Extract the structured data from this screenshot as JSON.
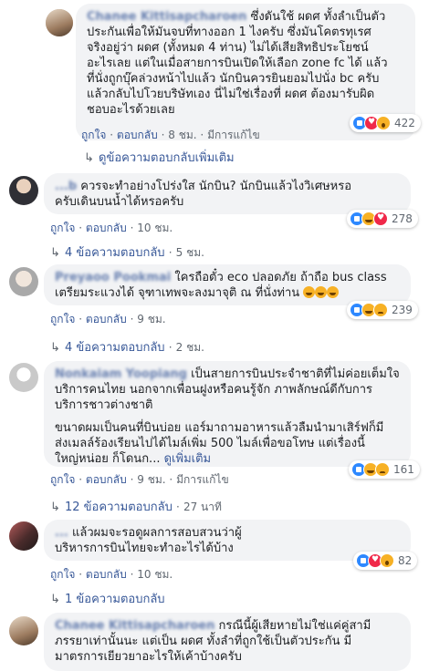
{
  "comments": [
    {
      "author": "Chanee Kittisapcharoen",
      "text_lines": [
        "ซึ่งดันใช้ ผดศ ทั้งลำเป็นตัว",
        "ประกันเพื่อให้มันจบที่ทางออก 1 ไงครับ ซึ่งมันโคตรทุเรศ",
        "จริงอยู่ว่า ผดศ (ทั้งหมด 4 ท่าน) ไม่ได้เสียสิทธิประโยชน์",
        "อะไรเลย แต่ในเมื่อสายการบินเปิดให้เลือก zone fc ได้ แล้ว",
        "ที่นั่งถูกบุ๊คล่วงหน้าไปแล้ว นักบินควรยินยอมไปนั่ง bc ครับ",
        "แล้วกลับไปโวยบริษัทเอง นี่ไม่ใช่เรื่องที่ ผดศ ต้องมารับผิด",
        "ชอบอะไรด้วยเลย"
      ],
      "like": "ถูกใจ",
      "reply": "ตอบกลับ",
      "time": "8 ชม.",
      "edited": "มีการแก้ไข",
      "reaction_count": "422",
      "reactions": [
        "like-icon",
        "love-icon",
        "wow-icon"
      ]
    },
    {
      "author": "...b",
      "text_lines": [
        "ควรจะทำอย่างโปร่งใส นักบิน? นักบินแล้วไงวิเศษหรอ",
        "ครับเดินบนน้ำได้หรอครับ"
      ],
      "like": "ถูกใจ",
      "reply": "ตอบกลับ",
      "time": "10 ชม.",
      "reaction_count": "278",
      "reactions": [
        "like-icon",
        "haha-icon",
        "love-icon"
      ],
      "replies_link": "4 ข้อความตอบกลับ",
      "replies_time": "5 ชม."
    },
    {
      "author": "Preyaoo Pookmai",
      "text_lines": [
        "ใครถือตั๋ว eco ปลอดภัย ถ้าถือ bus class",
        "เตรียมระแวงได้ จุฑาเทพจะลงมาจุติ ณ ที่นั่งท่าน"
      ],
      "like": "ถูกใจ",
      "reply": "ตอบกลับ",
      "time": "9 ชม.",
      "reaction_count": "239",
      "reactions": [
        "like-icon",
        "haha-icon",
        "sad-icon"
      ],
      "replies_link": "4 ข้อความตอบกลับ",
      "replies_time": "2 ชม."
    },
    {
      "author": "Nonkaiam Yoopiang",
      "text_lines": [
        "เป็นสายการบินประจำชาติที่ไม่ค่อยเต็มใจ",
        "บริการคนไทย นอกจากเพื่อนฝูงหรือคนรู้จัก ภาพลักษณ์ดีกับการ",
        "บริการชาวต่างชาติ"
      ],
      "text_lines_2": [
        "ขนาดผมเป็นคนที่บินบ่อย แอร์มาถามอาหารแล้วลืมนำมาเสิร์ฟก็มี",
        "ส่งเมลล์ร้องเรียนไปได้ไมล์เพิ่ม 500 ไมล์เพื่อขอโทษ แต่เรื่องนี้",
        "ใหญ่หน่อย ก็โดนก...",
        "ดูเพิ่มเติม"
      ],
      "like": "ถูกใจ",
      "reply": "ตอบกลับ",
      "time": "9 ชม.",
      "edited": "มีการแก้ไข",
      "reaction_count": "161",
      "reactions": [
        "like-icon",
        "haha-icon",
        "sad-icon"
      ],
      "replies_link": "12 ข้อความตอบกลับ",
      "replies_time": "27 นาที"
    },
    {
      "author": "...",
      "text_lines": [
        "แล้วผมจะรอดูผลการสอบสวนว่าผู้",
        "บริหารการบินไทยจะทำอะไรได้บ้าง"
      ],
      "like": "ถูกใจ",
      "reply": "ตอบกลับ",
      "time": "10 ชม.",
      "reaction_count": "82",
      "reactions": [
        "like-icon",
        "love-icon",
        "wow-icon"
      ],
      "replies_link": "1 ข้อความตอบกลับ"
    },
    {
      "author": "Chanee Kittisapcharoen",
      "text_lines": [
        "กรณีนี้ผู้เสียหายไม่ใช่แค่คู่สามี",
        "ภรรยาเท่านั้นนะ แต่เป็น ผดศ ทั้งลำที่ถูกใช้เป็นตัวประกัน มี",
        "มาตรการเยียวยาอะไรให้เค้าบ้างครับ"
      ]
    }
  ],
  "reply_more": "ดูข้อความตอบกลับเพิ่มเติม",
  "separator": "·",
  "colors": {
    "link": "#385898",
    "bubble": "#f2f3f5",
    "meta": "#606770"
  }
}
